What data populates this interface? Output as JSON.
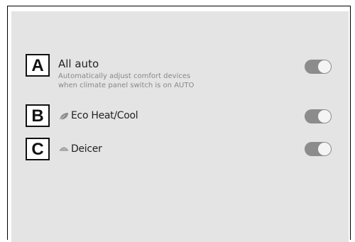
{
  "settings": {
    "items": [
      {
        "badge": "A",
        "label": "All auto",
        "description_line1": "Automatically adjust comfort devices",
        "description_line2": "when climate panel switch is on AUTO",
        "toggle_state": "on"
      },
      {
        "badge": "B",
        "label": "Eco Heat/Cool",
        "icon": "leaf-icon",
        "toggle_state": "on"
      },
      {
        "badge": "C",
        "label": "Deicer",
        "icon": "defroster-icon",
        "toggle_state": "on"
      }
    ]
  },
  "colors": {
    "screen_background": "#e4e4e4",
    "toggle_track": "#8c8c8c",
    "toggle_knob": "#f4f4f4"
  }
}
